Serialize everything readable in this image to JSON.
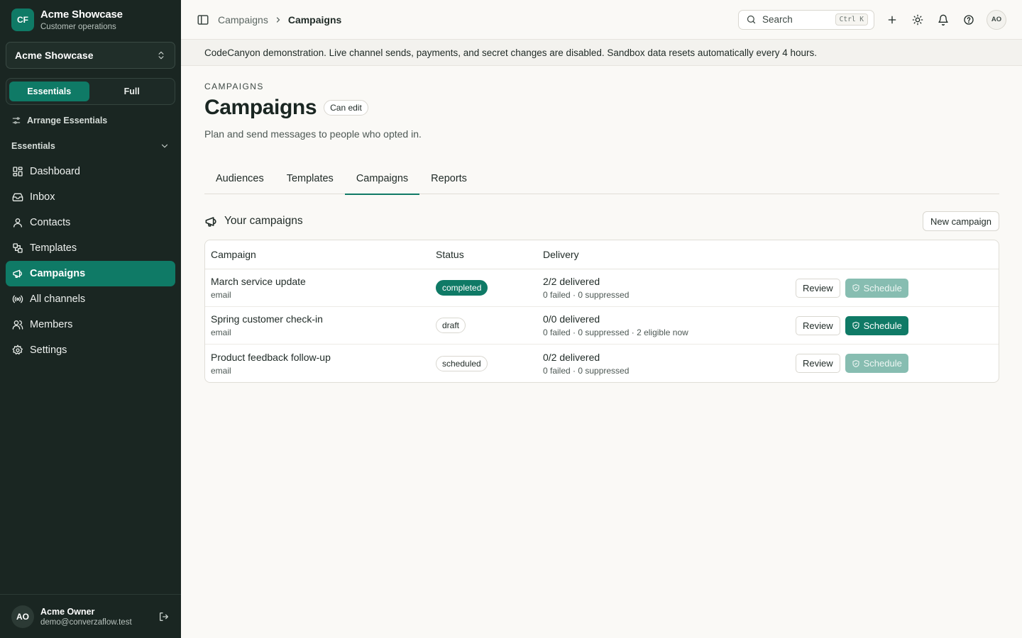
{
  "workspace": {
    "logo": "CF",
    "name": "Acme Showcase",
    "subtitle": "Customer operations",
    "selected": "Acme Showcase"
  },
  "mode": {
    "essentials": "Essentials",
    "full": "Full",
    "active": "Essentials"
  },
  "sidebar": {
    "arrange_label": "Arrange Essentials",
    "section_label": "Essentials",
    "items": [
      {
        "label": "Dashboard",
        "icon": "grid-icon"
      },
      {
        "label": "Inbox",
        "icon": "inbox-icon"
      },
      {
        "label": "Contacts",
        "icon": "user-icon"
      },
      {
        "label": "Templates",
        "icon": "template-icon"
      },
      {
        "label": "Campaigns",
        "icon": "megaphone-icon",
        "active": true
      },
      {
        "label": "All channels",
        "icon": "broadcast-icon"
      },
      {
        "label": "Members",
        "icon": "users-icon"
      },
      {
        "label": "Settings",
        "icon": "gear-icon"
      }
    ]
  },
  "user": {
    "initials": "AO",
    "name": "Acme Owner",
    "email": "demo@converzaflow.test"
  },
  "topbar": {
    "breadcrumb": [
      "Campaigns",
      "Campaigns"
    ],
    "search_label": "Search",
    "shortcut": "Ctrl K",
    "avatar": "AO"
  },
  "banner": "CodeCanyon demonstration. Live channel sends, payments, and secret changes are disabled. Sandbox data resets automatically every 4 hours.",
  "page": {
    "eyebrow": "CAMPAIGNS",
    "title": "Campaigns",
    "permission": "Can edit",
    "subtitle": "Plan and send messages to people who opted in."
  },
  "tabs": [
    "Audiences",
    "Templates",
    "Campaigns",
    "Reports"
  ],
  "active_tab": "Campaigns",
  "campaigns_section": {
    "title": "Your campaigns",
    "new_button": "New campaign"
  },
  "table": {
    "headers": [
      "Campaign",
      "Status",
      "Delivery",
      ""
    ],
    "review_label": "Review",
    "schedule_label": "Schedule",
    "rows": [
      {
        "name": "March service update",
        "channel": "email",
        "status": "completed",
        "delivery": "2/2 delivered",
        "delivery_detail": "0 failed · 0 suppressed",
        "schedule_enabled": false
      },
      {
        "name": "Spring customer check-in",
        "channel": "email",
        "status": "draft",
        "delivery": "0/0 delivered",
        "delivery_detail": "0 failed · 0 suppressed · 2 eligible now",
        "schedule_enabled": true
      },
      {
        "name": "Product feedback follow-up",
        "channel": "email",
        "status": "scheduled",
        "delivery": "0/2 delivered",
        "delivery_detail": "0 failed · 0 suppressed",
        "schedule_enabled": false
      }
    ]
  },
  "colors": {
    "accent": "#0f7a66",
    "sidebar_bg": "#1a2622",
    "page_bg": "#faf9f6"
  }
}
